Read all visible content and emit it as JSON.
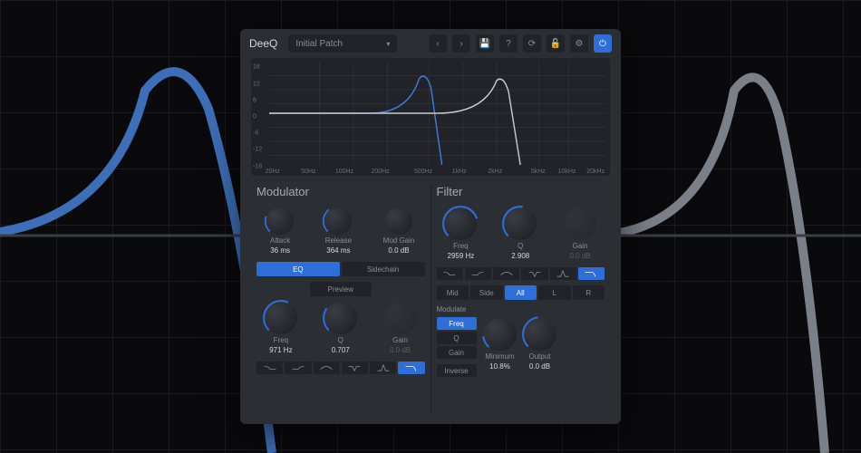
{
  "topbar": {
    "title": "DeeQ",
    "preset": "Initial Patch",
    "power": "⏻"
  },
  "graph": {
    "yticks": [
      "18",
      "12",
      "6",
      "0",
      "-6",
      "-12",
      "-18"
    ],
    "xticks": [
      "20Hz",
      "50Hz",
      "100Hz",
      "200Hz",
      "500Hz",
      "1kHz",
      "2kHz",
      "5kHz",
      "10kHz",
      "20kHz"
    ]
  },
  "modulator": {
    "title": "Modulator",
    "attack": {
      "label": "Attack",
      "value": "36 ms"
    },
    "release": {
      "label": "Release",
      "value": "364 ms"
    },
    "modgain": {
      "label": "Mod Gain",
      "value": "0.0 dB"
    },
    "tabs": {
      "eq": "EQ",
      "sidechain": "Sidechain"
    },
    "preview": "Preview",
    "freq": {
      "label": "Freq",
      "value": "971 Hz"
    },
    "q": {
      "label": "Q",
      "value": "0.707"
    },
    "gain": {
      "label": "Gain",
      "value": "0.0 dB"
    }
  },
  "filter": {
    "title": "Filter",
    "freq": {
      "label": "Freq",
      "value": "2959 Hz"
    },
    "q": {
      "label": "Q",
      "value": "2.908"
    },
    "gain": {
      "label": "Gain",
      "value": "0.0 dB"
    },
    "channels": {
      "mid": "Mid",
      "side": "Side",
      "all": "All",
      "l": "L",
      "r": "R"
    },
    "modulate_label": "Modulate",
    "mod_freq": "Freq",
    "mod_q": "Q",
    "mod_gain": "Gain",
    "inverse": "Inverse",
    "minimum": {
      "label": "Minimum",
      "value": "10.8%"
    },
    "output": {
      "label": "Output",
      "value": "0.0 dB"
    }
  }
}
